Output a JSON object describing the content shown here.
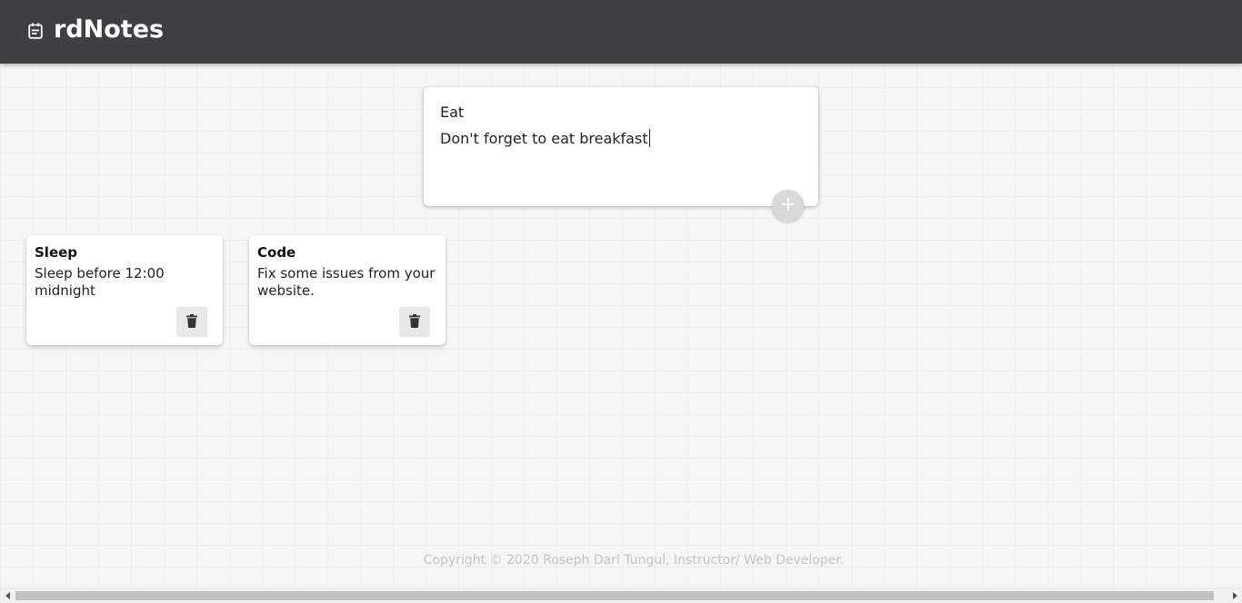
{
  "app": {
    "title": "rdNotes",
    "icon": "note-calendar-icon"
  },
  "composer": {
    "title_value": "Eat",
    "content_value": "Don't forget to eat breakfast",
    "add_icon": "plus-icon"
  },
  "notes": [
    {
      "title": "Sleep",
      "content": "Sleep before 12:00 midnight",
      "delete_icon": "trash-icon"
    },
    {
      "title": "Code",
      "content": "Fix some issues from your website.",
      "delete_icon": "trash-icon"
    }
  ],
  "footer": {
    "text": "Copyright © 2020 Roseph Darl Tungul, Instructor/ Web Developer."
  },
  "colors": {
    "header_bg": "#3f3e43",
    "page_bg": "#f6f6f6",
    "card_bg": "#ffffff",
    "footer_text": "#c4c4c4"
  }
}
